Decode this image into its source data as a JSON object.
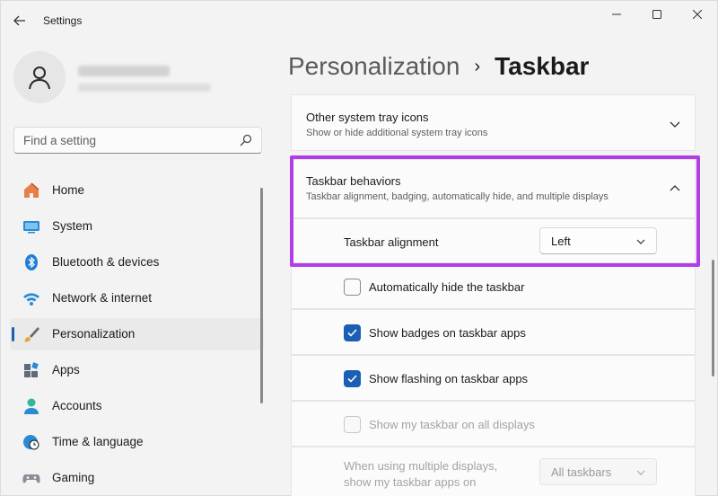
{
  "window": {
    "title": "Settings"
  },
  "search": {
    "placeholder": "Find a setting"
  },
  "nav": {
    "items": [
      {
        "label": "Home",
        "icon": "home-icon"
      },
      {
        "label": "System",
        "icon": "system-icon"
      },
      {
        "label": "Bluetooth & devices",
        "icon": "bluetooth-icon"
      },
      {
        "label": "Network & internet",
        "icon": "wifi-icon"
      },
      {
        "label": "Personalization",
        "icon": "paintbrush-icon",
        "active": true
      },
      {
        "label": "Apps",
        "icon": "apps-icon"
      },
      {
        "label": "Accounts",
        "icon": "accounts-icon"
      },
      {
        "label": "Time & language",
        "icon": "globe-clock-icon"
      },
      {
        "label": "Gaming",
        "icon": "gamepad-icon"
      }
    ]
  },
  "header": {
    "parent": "Personalization",
    "separator": "›",
    "current": "Taskbar"
  },
  "sections": {
    "tray": {
      "title": "Other system tray icons",
      "subtitle": "Show or hide additional system tray icons"
    },
    "behaviors": {
      "title": "Taskbar behaviors",
      "subtitle": "Taskbar alignment, badging, automatically hide, and multiple displays"
    }
  },
  "alignment": {
    "label": "Taskbar alignment",
    "value": "Left"
  },
  "options": {
    "autohide": {
      "label": "Automatically hide the taskbar",
      "checked": false
    },
    "badges": {
      "label": "Show badges on taskbar apps",
      "checked": true
    },
    "flashing": {
      "label": "Show flashing on taskbar apps",
      "checked": true
    },
    "all_displays": {
      "label": "Show my taskbar on all displays",
      "checked": false,
      "disabled": true
    }
  },
  "multi_display": {
    "label_line1": "When using multiple displays,",
    "label_line2": "show my taskbar apps on",
    "value": "All taskbars"
  },
  "colors": {
    "accent": "#1a5fb4",
    "highlight": "#b13ee6"
  }
}
